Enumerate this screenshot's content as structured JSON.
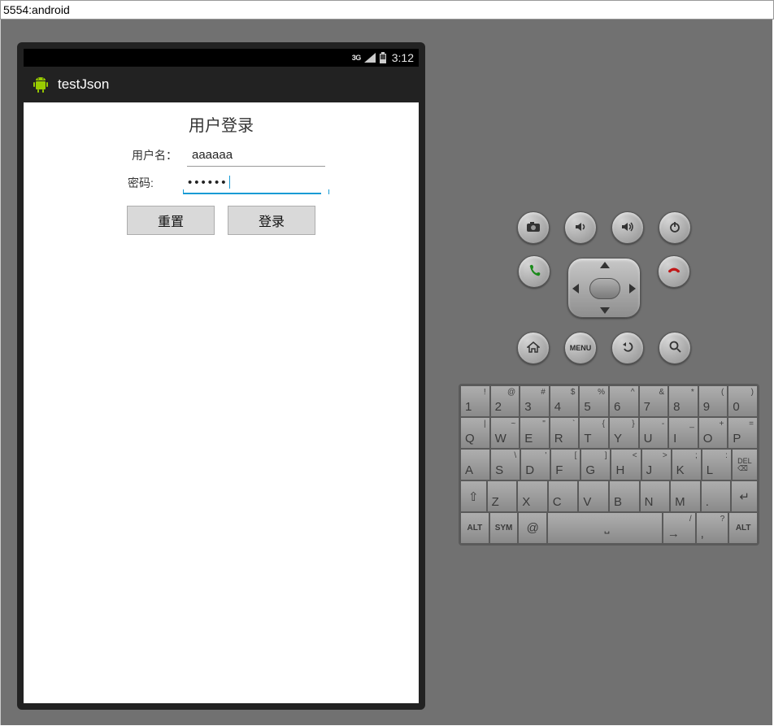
{
  "window": {
    "title": "5554:android"
  },
  "status": {
    "net": "3G",
    "time": "3:12"
  },
  "actionbar": {
    "title": "testJson"
  },
  "form": {
    "heading": "用户登录",
    "username_label": "用户名：",
    "username_value": "aaaaaa",
    "password_label": "密码:",
    "password_value": "••••••",
    "reset_label": "重置",
    "login_label": "登录"
  },
  "hw": {
    "menu_label": "MENU"
  },
  "keys": {
    "r1": [
      {
        "m": "1",
        "s": "!"
      },
      {
        "m": "2",
        "s": "@"
      },
      {
        "m": "3",
        "s": "#"
      },
      {
        "m": "4",
        "s": "$"
      },
      {
        "m": "5",
        "s": "%"
      },
      {
        "m": "6",
        "s": "^"
      },
      {
        "m": "7",
        "s": "&"
      },
      {
        "m": "8",
        "s": "*"
      },
      {
        "m": "9",
        "s": "("
      },
      {
        "m": "0",
        "s": ")"
      }
    ],
    "r2": [
      {
        "m": "Q",
        "s": "|"
      },
      {
        "m": "W",
        "s": "~"
      },
      {
        "m": "E",
        "s": "\""
      },
      {
        "m": "R",
        "s": "`"
      },
      {
        "m": "T",
        "s": "{"
      },
      {
        "m": "Y",
        "s": "}"
      },
      {
        "m": "U",
        "s": "-"
      },
      {
        "m": "I",
        "s": "_"
      },
      {
        "m": "O",
        "s": "+"
      },
      {
        "m": "P",
        "s": "="
      }
    ],
    "r3": [
      {
        "m": "A",
        "s": ""
      },
      {
        "m": "S",
        "s": "\\"
      },
      {
        "m": "D",
        "s": "'"
      },
      {
        "m": "F",
        "s": "["
      },
      {
        "m": "G",
        "s": "]"
      },
      {
        "m": "H",
        "s": "<"
      },
      {
        "m": "J",
        "s": ">"
      },
      {
        "m": "K",
        "s": ";"
      },
      {
        "m": "L",
        "s": ":"
      }
    ],
    "del": "DEL",
    "r4": [
      {
        "m": "Z"
      },
      {
        "m": "X"
      },
      {
        "m": "C"
      },
      {
        "m": "V"
      },
      {
        "m": "B"
      },
      {
        "m": "N"
      },
      {
        "m": "M"
      },
      {
        "m": "."
      },
      {
        "m": ",",
        "s": ""
      }
    ],
    "alt": "ALT",
    "sym": "SYM",
    "at": "@",
    "slash": "/",
    "question": "?"
  }
}
